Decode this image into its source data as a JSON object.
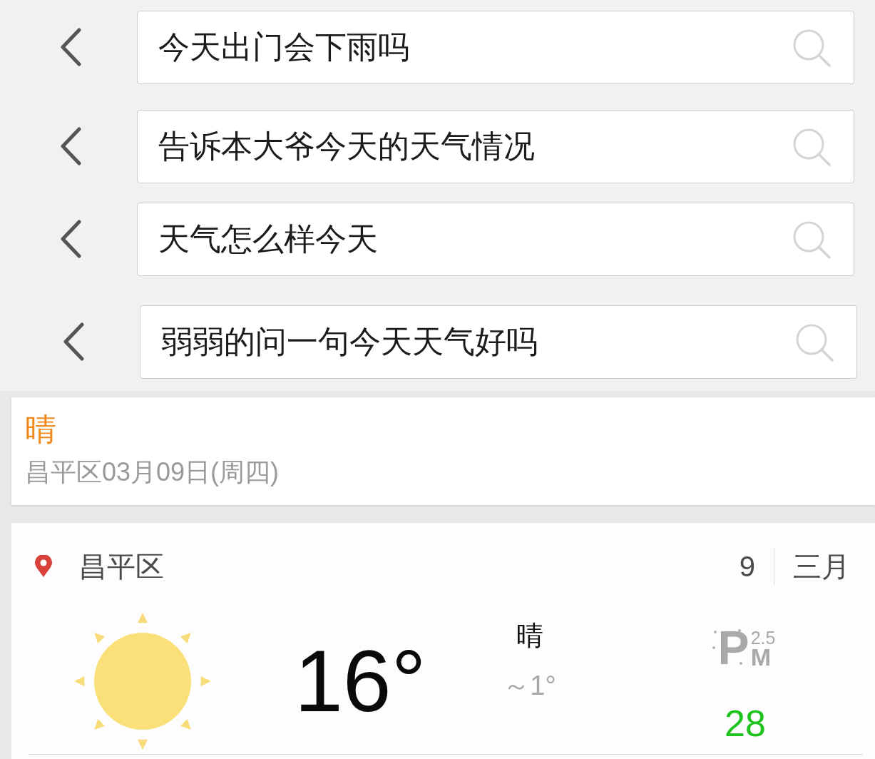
{
  "search_rows": [
    {
      "query": "今天出门会下雨吗"
    },
    {
      "query": "告诉本大爷今天的天气情况"
    },
    {
      "query": "天气怎么样今天"
    },
    {
      "query": "弱弱的问一句今天天气好吗"
    }
  ],
  "summary": {
    "condition": "晴",
    "location_date": "昌平区03月09日(周四)"
  },
  "weather_card": {
    "location": "昌平区",
    "day": "9",
    "month": "三月",
    "temperature": "16°",
    "condition": "晴",
    "range": "～1°",
    "pm_icon": {
      "letter": "P",
      "sup": "2.5",
      "sub": "M"
    },
    "aqi": "28"
  }
}
